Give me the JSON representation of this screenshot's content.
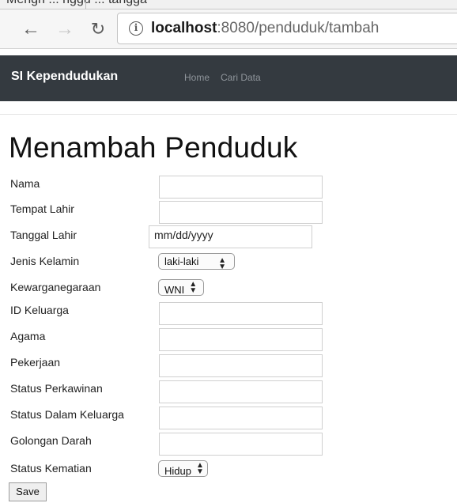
{
  "tab": {
    "partial_title": "Mengh ... nggu ... tangga"
  },
  "browser": {
    "url_host": "localhost",
    "url_path": ":8080/penduduk/tambah"
  },
  "navbar": {
    "brand": "SI Kependudukan",
    "links": [
      "Home",
      "Cari Data"
    ]
  },
  "page": {
    "title": "Menambah Penduduk"
  },
  "form": {
    "fields": {
      "nama": {
        "label": "Nama",
        "value": ""
      },
      "tempat_lahir": {
        "label": "Tempat Lahir",
        "value": ""
      },
      "tanggal_lahir": {
        "label": "Tanggal Lahir",
        "placeholder": "mm/dd/yyyy"
      },
      "jenis_kelamin": {
        "label": "Jenis Kelamin",
        "selected": "laki-laki"
      },
      "kewarganegaraan": {
        "label": "Kewarganegaraan",
        "selected": "WNI"
      },
      "id_keluarga": {
        "label": "ID Keluarga",
        "value": ""
      },
      "agama": {
        "label": "Agama",
        "value": ""
      },
      "pekerjaan": {
        "label": "Pekerjaan",
        "value": ""
      },
      "status_perkawinan": {
        "label": "Status Perkawinan",
        "value": ""
      },
      "status_dalam_keluarga": {
        "label": "Status Dalam Keluarga",
        "value": ""
      },
      "golongan_darah": {
        "label": "Golongan Darah",
        "value": ""
      },
      "status_kematian": {
        "label": "Status Kematian",
        "selected": "Hidup"
      }
    },
    "save_label": "Save"
  },
  "icons": {
    "back": "arrow-left-icon",
    "forward": "arrow-right-icon",
    "reload": "reload-icon",
    "info": "info-icon",
    "select_caret": "up-down-caret-icon"
  },
  "colors": {
    "navbar_bg": "#343a40",
    "navbar_link": "#8f959b",
    "brand_text": "#ffffff"
  }
}
